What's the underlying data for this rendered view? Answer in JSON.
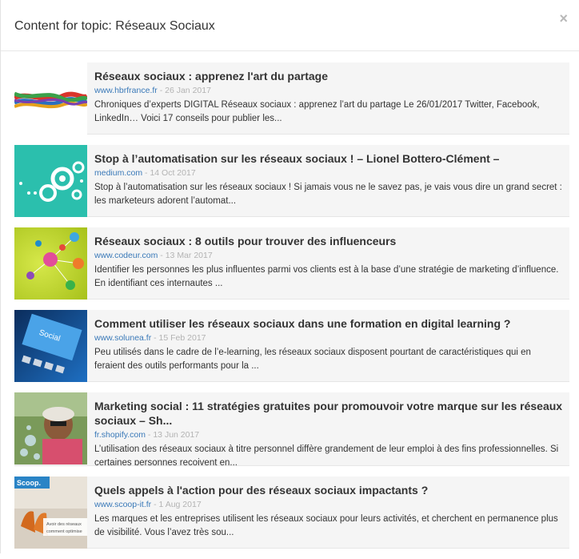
{
  "modal": {
    "title": "Content for topic: Réseaux Sociaux",
    "close_label": "×"
  },
  "items": [
    {
      "title": "Réseaux sociaux : apprenez l'art du partage",
      "source": "www.hbrfrance.fr",
      "separator": " - ",
      "date": "26 Jan 2017",
      "description": "Chroniques d’experts DIGITAL Réseaux sociaux : apprenez l’art du partage Le 26/01/2017 Twitter, Facebook, LinkedIn… Voici 17 conseils pour publier les...",
      "thumb_icon": "braided-ropes-image"
    },
    {
      "title": "Stop à l’automatisation sur les réseaux sociaux ! – Lionel Bottero-Clément –",
      "source": "medium.com",
      "separator": " - ",
      "date": "14 Oct 2017",
      "description": "Stop à l’automatisation sur les réseaux sociaux ! Si jamais vous ne le savez pas, je vais vous dire un grand secret : les marketeurs adorent l’automat...",
      "thumb_icon": "gears-image"
    },
    {
      "title": "Réseaux sociaux : 8 outils pour trouver des influenceurs",
      "source": "www.codeur.com",
      "separator": " - ",
      "date": "13 Mar 2017",
      "description": "Identifier les personnes les plus influentes parmi vos clients est à la base d’une stratégie de marketing d’influence. En identifiant ces internautes ...",
      "thumb_icon": "social-network-icons-image"
    },
    {
      "title": "Comment utiliser les réseaux sociaux dans une formation en digital learning ?",
      "source": "www.solunea.fr",
      "separator": " - ",
      "date": "15 Feb 2017",
      "description": "Peu utilisés dans le cadre de l’e-learning, les réseaux sociaux disposent pourtant de caractéristiques qui en feraient des outils performants pour la ...",
      "thumb_icon": "social-keyboard-image",
      "thumb_text": "Social"
    },
    {
      "title": "Marketing social : 11 stratégies gratuites pour promouvoir votre marque sur les réseaux sociaux – Sh...",
      "source": "fr.shopify.com",
      "separator": " - ",
      "date": "13 Jun 2017",
      "description": "L’utilisation des réseaux sociaux à titre personnel diffère grandement de leur emploi à des fins professionnelles. Si certaines personnes reçoivent en...",
      "thumb_icon": "man-with-bubbles-image"
    },
    {
      "title": "Quels appels à l'action pour des réseaux sociaux impactants ?",
      "source": "www.scoop-it.fr",
      "separator": " - ",
      "date": "1 Aug 2017",
      "description": "Les marques et les entreprises utilisent les réseaux sociaux pour leurs activités, et cherchent en permanence plus de visibilité. Vous l’avez très sou...",
      "thumb_icon": "scoopit-chairs-image",
      "thumb_logo": "Scoop.",
      "thumb_caption_1": "Avoir des réseaux",
      "thumb_caption_2": "comment optimise"
    }
  ]
}
